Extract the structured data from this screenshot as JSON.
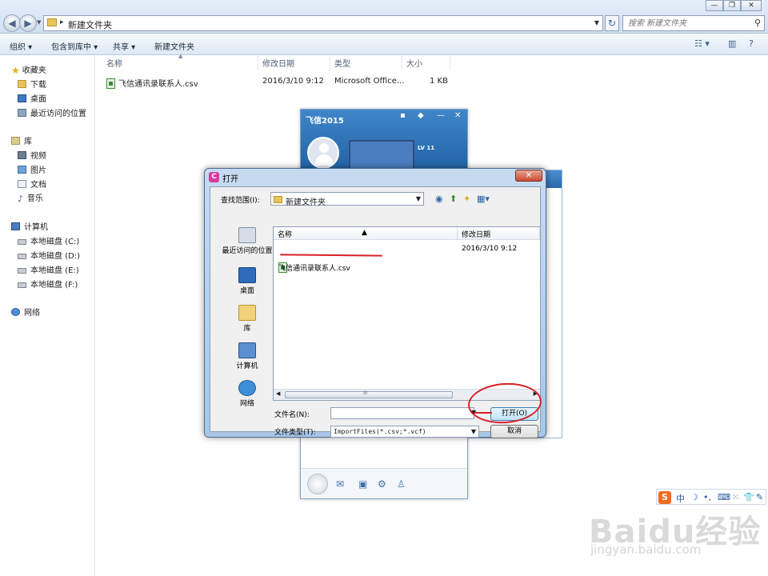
{
  "explorer": {
    "path": "新建文件夹",
    "search_placeholder": "搜索 新建文件夹",
    "toolbar": [
      "组织 ▾",
      "包含到库中 ▾",
      "共享 ▾",
      "新建文件夹"
    ],
    "nav": {
      "favorites": "收藏夹",
      "downloads": "下载",
      "desktop": "桌面",
      "recent": "最近访问的位置",
      "libraries": "库",
      "videos": "视频",
      "pictures": "图片",
      "documents": "文档",
      "music": "音乐",
      "computer": "计算机",
      "disk_c": "本地磁盘 (C:)",
      "disk_d": "本地磁盘 (D:)",
      "disk_e": "本地磁盘 (E:)",
      "disk_f": "本地磁盘 (F:)",
      "network": "网络"
    },
    "columns": {
      "name": "名称",
      "modified": "修改日期",
      "type": "类型",
      "size": "大小"
    },
    "file": {
      "name": "飞信通讯录联系人.csv",
      "modified": "2016/3/10 9:12",
      "type": "Microsoft Office...",
      "size": "1 KB"
    }
  },
  "fetion": {
    "title": "飞信2015",
    "level": "LV 11"
  },
  "dialog": {
    "title": "打开",
    "lookin_label": "查找范围(I):",
    "lookin_value": "新建文件夹",
    "places": [
      "最近访问的位置",
      "桌面",
      "库",
      "计算机",
      "网络"
    ],
    "columns": {
      "name": "名称",
      "modified": "修改日期"
    },
    "file": {
      "name": "飞信通讯录联系人.csv",
      "modified": "2016/3/10 9:12"
    },
    "filename_label": "文件名(N):",
    "filename_value": "",
    "filetype_label": "文件类型(T):",
    "filetype_value": "ImportFiles(*.csv;*.vcf)",
    "open_button": "打开(O)",
    "cancel_button": "取消"
  },
  "tray": {
    "ime": "中"
  },
  "watermark": {
    "text": "Baidu经验",
    "url": "jingyan.baidu.com"
  },
  "colors": {
    "annotation_red": "#d9202a",
    "fetion_blue": "#2f71b5",
    "dialog_accent": "#d93aa0"
  }
}
